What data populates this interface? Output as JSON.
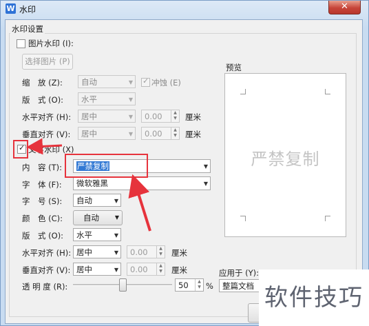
{
  "window": {
    "title": "水印",
    "app_icon": "W",
    "close_label": "✕"
  },
  "group_label": "水印设置",
  "image_watermark": {
    "checkbox_label": "图片水印 (I):",
    "checked": false,
    "select_button": "选择图片 (P)",
    "scale_label": "缩　放 (Z):",
    "scale_value": "自动",
    "washout_label": "冲蚀 (E)",
    "washout_checked": true,
    "layout_label": "版　式 (O):",
    "layout_value": "水平",
    "halign_label": "水平对齐 (H):",
    "halign_value": "居中",
    "halign_offset": "0.00",
    "valign_label": "垂直对齐 (V):",
    "valign_value": "居中",
    "valign_offset": "0.00",
    "unit": "厘米"
  },
  "text_watermark": {
    "checkbox_label": "文字水印 (X)",
    "checked": true,
    "content_label": "内　容 (T):",
    "content_value": "严禁复制",
    "font_label": "字　体 (F):",
    "font_value": "微软雅黑",
    "size_label": "字　号 (S):",
    "size_value": "自动",
    "color_label": "颜　色 (C):",
    "color_value": "自动",
    "layout_label": "版　式 (O):",
    "layout_value": "水平",
    "halign_label": "水平对齐 (H):",
    "halign_value": "居中",
    "halign_offset": "0.00",
    "valign_label": "垂直对齐 (V):",
    "valign_value": "居中",
    "valign_offset": "0.00",
    "unit": "厘米",
    "transparency_label": "透 明 度 (R):",
    "transparency_value": "50",
    "transparency_unit": "%",
    "transparency_fraction": 0.5
  },
  "preview": {
    "label": "预览",
    "watermark_text": "严禁复制"
  },
  "apply_to": {
    "label": "应用于 (Y):",
    "value": "整篇文档"
  },
  "overlay_text": "软件技巧",
  "colors": {
    "annotation_red": "#e6333c",
    "accent_blue": "#2f73d6"
  }
}
